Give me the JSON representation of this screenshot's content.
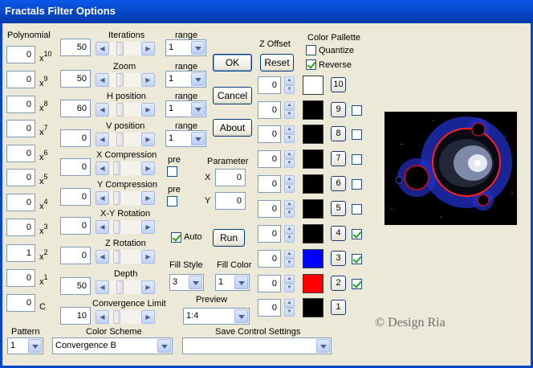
{
  "window": {
    "title": "Fractals Filter Options"
  },
  "polynomial": {
    "label": "Polynomial",
    "terms": [
      {
        "value": "0",
        "base": "x",
        "exp": "10"
      },
      {
        "value": "0",
        "base": "x",
        "exp": "9"
      },
      {
        "value": "0",
        "base": "x",
        "exp": "8"
      },
      {
        "value": "0",
        "base": "x",
        "exp": "7"
      },
      {
        "value": "0",
        "base": "x",
        "exp": "6"
      },
      {
        "value": "0",
        "base": "x",
        "exp": "5"
      },
      {
        "value": "0",
        "base": "x",
        "exp": "4"
      },
      {
        "value": "0",
        "base": "x",
        "exp": "3"
      },
      {
        "value": "1",
        "base": "x",
        "exp": "2"
      },
      {
        "value": "0",
        "base": "x",
        "exp": "1"
      },
      {
        "value": "0",
        "base": "C",
        "exp": ""
      }
    ]
  },
  "params": [
    {
      "label": "Iterations",
      "value": "50",
      "range_label": "range",
      "range_value": "1",
      "slider_level": 0.3
    },
    {
      "label": "Zoom",
      "value": "50",
      "range_label": "range",
      "range_value": "1",
      "slider_level": 0.3
    },
    {
      "label": "H position",
      "value": "60",
      "range_label": "range",
      "range_value": "1",
      "slider_level": 0.3
    },
    {
      "label": "V position",
      "value": "0",
      "range_label": "range",
      "range_value": "1",
      "slider_level": 0.3
    },
    {
      "label": "X Compression",
      "value": "0",
      "pre_label": "pre",
      "slider_level": 0.15
    },
    {
      "label": "Y Compression",
      "value": "0",
      "pre_label": "pre",
      "slider_level": 0.15
    },
    {
      "label": "X-Y Rotation",
      "value": "0",
      "slider_level": 0.15
    },
    {
      "label": "Z Rotation",
      "value": "0",
      "slider_level": 0.15
    },
    {
      "label": "Depth",
      "value": "50",
      "slider_level": 0.3
    },
    {
      "label": "Convergence Limit",
      "value": "10",
      "slider_level": 0.15
    }
  ],
  "buttons": {
    "ok": "OK",
    "cancel": "Cancel",
    "about": "About",
    "run": "Run",
    "reset": "Reset"
  },
  "auto": {
    "label": "Auto",
    "checked": true
  },
  "parameter": {
    "label": "Parameter",
    "x_label": "X",
    "x_value": "0",
    "y_label": "Y",
    "y_value": "0"
  },
  "fill_style": {
    "label": "Fill Style",
    "value": "3"
  },
  "fill_color": {
    "label": "Fill Color",
    "value": "1"
  },
  "preview": {
    "label": "Preview",
    "value": "1:4"
  },
  "z_offset": {
    "label": "Z Offset"
  },
  "color_pallette": {
    "label": "Color Pallette",
    "quantize_label": "Quantize",
    "quantize_checked": false,
    "reverse_label": "Reverse",
    "reverse_checked": true,
    "entries": [
      {
        "index": "10",
        "offset": "0",
        "color": "#ffffff",
        "checked": null
      },
      {
        "index": "9",
        "offset": "0",
        "color": "#000000",
        "checked": false
      },
      {
        "index": "8",
        "offset": "0",
        "color": "#000000",
        "checked": false
      },
      {
        "index": "7",
        "offset": "0",
        "color": "#000000",
        "checked": false
      },
      {
        "index": "6",
        "offset": "0",
        "color": "#000000",
        "checked": false
      },
      {
        "index": "5",
        "offset": "0",
        "color": "#000000",
        "checked": false
      },
      {
        "index": "4",
        "offset": "0",
        "color": "#000000",
        "checked": true
      },
      {
        "index": "3",
        "offset": "0",
        "color": "#0000ff",
        "checked": true
      },
      {
        "index": "2",
        "offset": "0",
        "color": "#ff0000",
        "checked": true
      },
      {
        "index": "1",
        "offset": "0",
        "color": "#000000",
        "checked": null
      }
    ]
  },
  "pattern": {
    "label": "Pattern",
    "value": "1"
  },
  "color_scheme": {
    "label": "Color Scheme",
    "value": "Convergence B"
  },
  "save_settings": {
    "label": "Save Control Settings",
    "value": ""
  },
  "watermark": "© Design Ria",
  "colors": {
    "titlebar": "#0a58e8",
    "dialog_bg": "#ece9d8",
    "fractal_blue": "#3344ff",
    "fractal_red": "#ff2222"
  }
}
